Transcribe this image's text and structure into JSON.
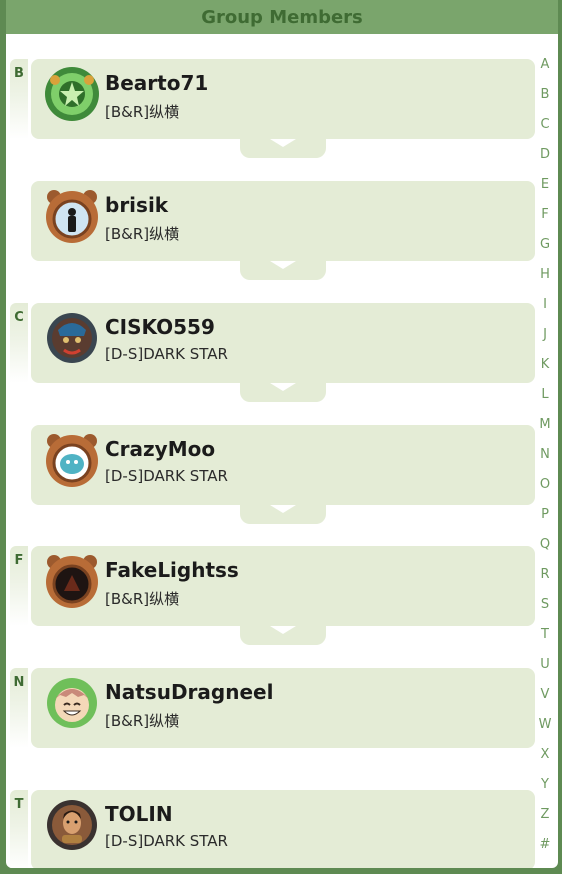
{
  "header": {
    "title": "Group Members"
  },
  "sections": [
    {
      "letter": "B"
    },
    {
      "letter": "C"
    },
    {
      "letter": "F"
    },
    {
      "letter": "N"
    },
    {
      "letter": "T"
    }
  ],
  "members": [
    {
      "name": "Bearto71",
      "group": "[B&R]纵横",
      "avatar": "green-dragon-emblem-avatar"
    },
    {
      "name": "brisik",
      "group": "[B&R]纵横",
      "avatar": "bear-frame-silhouette-avatar"
    },
    {
      "name": "CISKO559",
      "group": "[D-S]DARK STAR",
      "avatar": "tribal-warrior-avatar"
    },
    {
      "name": "CrazyMoo",
      "group": "[D-S]DARK STAR",
      "avatar": "bear-frame-cow-avatar"
    },
    {
      "name": "FakeLightss",
      "group": "[B&R]纵横",
      "avatar": "bear-frame-dark-avatar"
    },
    {
      "name": "NatsuDragneel",
      "group": "[B&R]纵横",
      "avatar": "smiling-anime-avatar"
    },
    {
      "name": "TOLIN",
      "group": "[D-S]DARK STAR",
      "avatar": "armored-hero-avatar"
    }
  ],
  "alphabet_index": [
    "A",
    "B",
    "C",
    "D",
    "E",
    "F",
    "G",
    "H",
    "I",
    "J",
    "K",
    "L",
    "M",
    "N",
    "O",
    "P",
    "Q",
    "R",
    "S",
    "T",
    "U",
    "V",
    "W",
    "X",
    "Y",
    "Z",
    "#"
  ],
  "colors": {
    "outer_background": "#5e8a52",
    "title_bar": "#7aa56c",
    "title_text": "#3f6b33",
    "card": "#e4ecd6",
    "index_text": "#6f9a61"
  }
}
